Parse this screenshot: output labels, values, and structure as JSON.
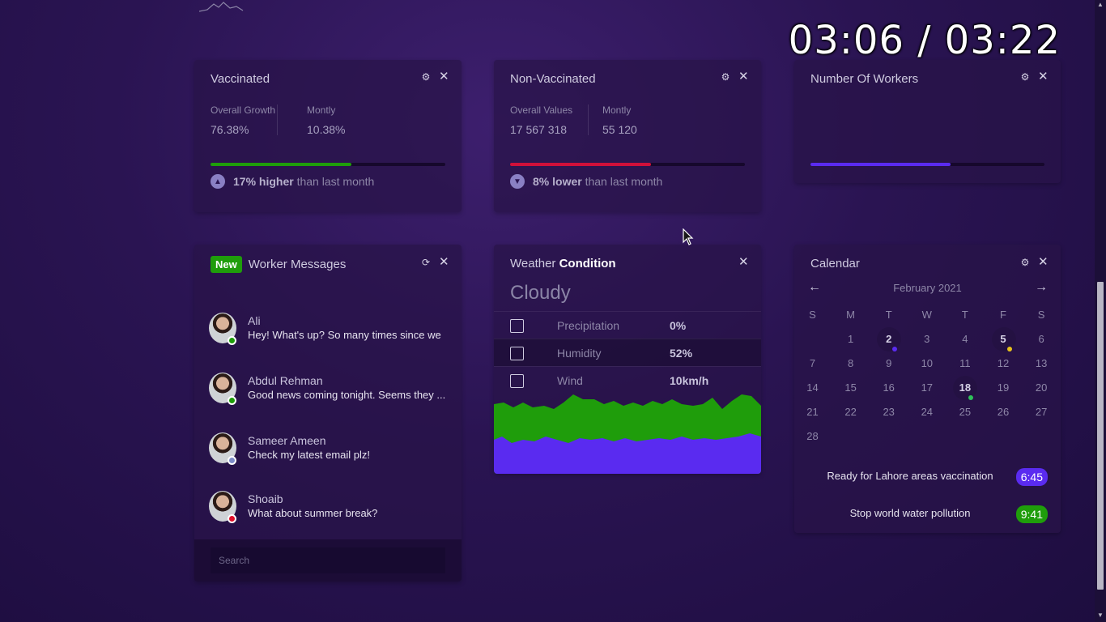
{
  "timer": "03:06 / 03:22",
  "colors": {
    "green": "#1f9d0b",
    "red": "#d0103a",
    "blue": "#5a2bf0",
    "avatar_online": "#1f9d0b",
    "avatar_away": "#7d8cc8",
    "avatar_busy": "#e0102a",
    "event_blue": "#5a2bf0",
    "event_green": "#1f9d0b"
  },
  "vaccinated": {
    "title": "Vaccinated",
    "stat1_label": "Overall Growth",
    "stat1_value": "76.38%",
    "stat2_label": "Montly",
    "stat2_value": "10.38%",
    "progress": 0.6,
    "trend_strong": "17% higher",
    "trend_rest": " than last month",
    "trend_icon": "chevron-up-icon"
  },
  "non_vaccinated": {
    "title": "Non-Vaccinated",
    "stat1_label": "Overall Values",
    "stat1_value": "17 567 318",
    "stat2_label": "Montly",
    "stat2_value": "55 120",
    "progress": 0.6,
    "trend_strong": "8% lower",
    "trend_rest": " than last month",
    "trend_icon": "chevron-down-icon"
  },
  "workers": {
    "title": "Number Of Workers",
    "progress": 0.6
  },
  "messages": {
    "badge": "New",
    "title": "Worker Messages",
    "items": [
      {
        "name": "Ali",
        "text": "Hey! What's up? So many times since we",
        "status": "online"
      },
      {
        "name": "Abdul Rehman",
        "text": "Good news coming tonight. Seems they ...",
        "status": "online"
      },
      {
        "name": "Sameer Ameen",
        "text": "Check my latest email plz!",
        "status": "away"
      },
      {
        "name": "Shoaib",
        "text": "What about summer break?",
        "status": "busy"
      }
    ],
    "search_placeholder": "Search"
  },
  "weather": {
    "title_plain": "Weather ",
    "title_bold": "Condition",
    "status": "Cloudy",
    "rows": [
      {
        "label": "Precipitation",
        "value": "0%"
      },
      {
        "label": "Humidity",
        "value": "52%"
      },
      {
        "label": "Wind",
        "value": "10km/h"
      }
    ]
  },
  "calendar": {
    "title": "Calendar",
    "month": "February 2021",
    "weekdays": [
      "S",
      "M",
      "T",
      "W",
      "T",
      "F",
      "S"
    ],
    "first_weekday": 1,
    "days_in_month": 28,
    "marked_days": [
      {
        "day": 2,
        "dot": "#5a2bf0"
      },
      {
        "day": 5,
        "dot": "#e8c21a"
      },
      {
        "day": 18,
        "dot": "#2fc05a"
      }
    ],
    "events": [
      {
        "text": "Ready for Lahore areas vaccination",
        "time": "6:45",
        "color": "#5a2bf0"
      },
      {
        "text": "Stop world water pollution",
        "time": "9:41",
        "color": "#1f9d0b"
      }
    ]
  }
}
